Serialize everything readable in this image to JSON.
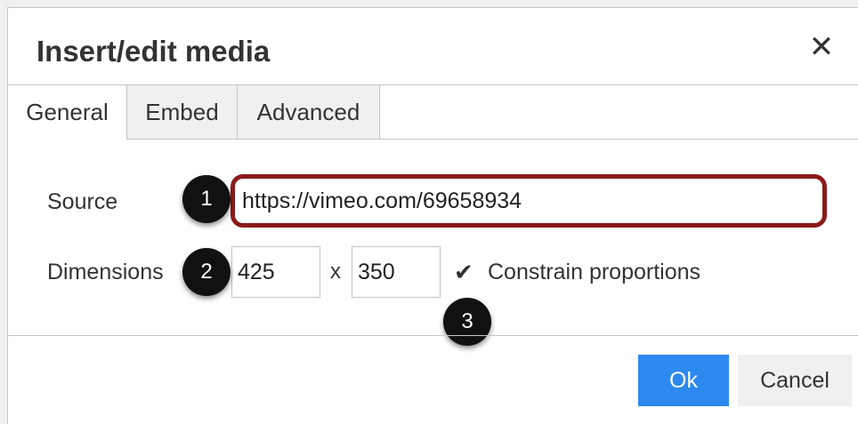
{
  "dialog": {
    "title": "Insert/edit media",
    "close_glyph": "✕"
  },
  "tabs": [
    {
      "label": "General",
      "active": true
    },
    {
      "label": "Embed",
      "active": false
    },
    {
      "label": "Advanced",
      "active": false
    }
  ],
  "form": {
    "source_label": "Source",
    "source_value": "https://vimeo.com/69658934",
    "dimensions_label": "Dimensions",
    "width_value": "425",
    "separator": "x",
    "height_value": "350",
    "constrain_checked": true,
    "constrain_glyph": "✔",
    "constrain_label": "Constrain proportions"
  },
  "badges": [
    "1",
    "2",
    "3"
  ],
  "buttons": {
    "ok_label": "Ok",
    "cancel_label": "Cancel"
  },
  "colors": {
    "ok_button": "#2d89ef",
    "highlight_border": "#8b1a1a",
    "badge": "#111111"
  },
  "icons": {
    "close": "close-icon",
    "check": "checkmark-icon"
  }
}
